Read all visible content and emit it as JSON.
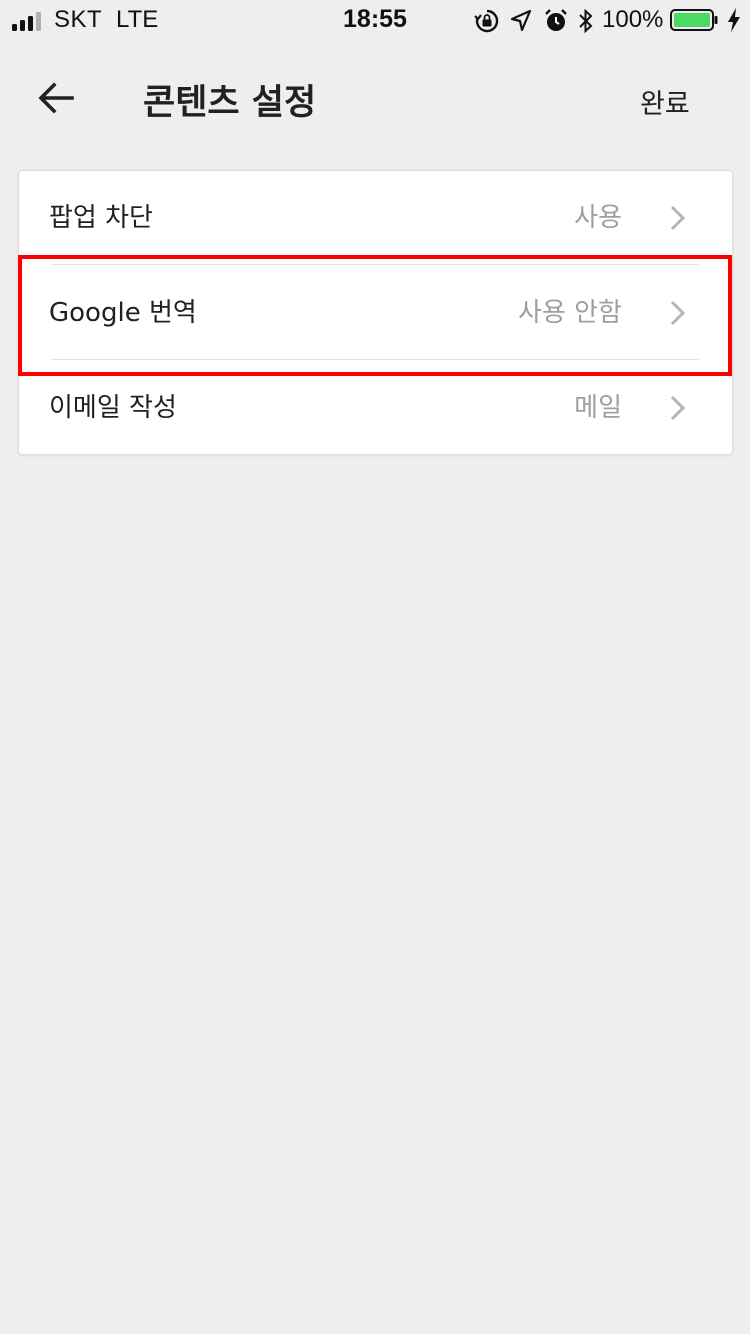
{
  "status_bar": {
    "carrier": "SKT",
    "network": "LTE",
    "time": "18:55",
    "battery_percent": "100%",
    "icons": [
      "signal-icon",
      "orientation-lock-icon",
      "location-arrow-icon",
      "alarm-icon",
      "bluetooth-icon",
      "battery-icon",
      "charging-icon"
    ],
    "battery_color": "#4cd964"
  },
  "header": {
    "back_icon": "arrow-left-icon",
    "title": "콘텐츠 설정",
    "done_label": "완료"
  },
  "settings": {
    "items": [
      {
        "label": "팝업 차단",
        "value": "사용"
      },
      {
        "label": "Google 번역",
        "value": "사용 안함"
      },
      {
        "label": "이메일 작성",
        "value": "메일"
      }
    ]
  },
  "highlight": {
    "color": "#ff0000",
    "target": "Google 번역"
  },
  "colors": {
    "background": "#eeeeee",
    "card": "#ffffff",
    "secondary_text": "#9e9e9e"
  }
}
